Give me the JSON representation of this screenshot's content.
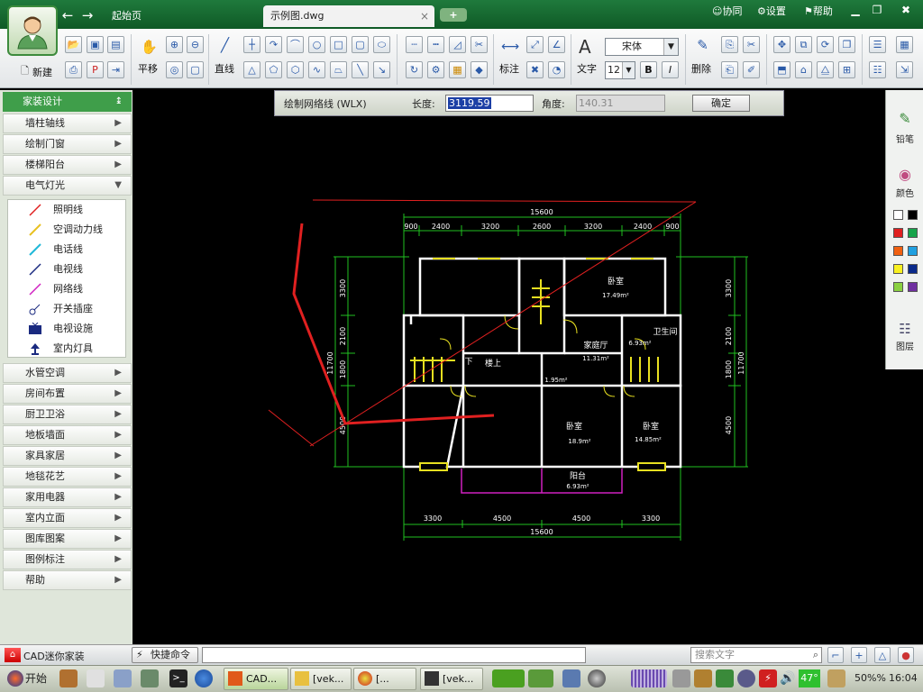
{
  "tabs": {
    "home": "起始页",
    "doc": "示例图.dwg",
    "doc_close": "×",
    "add": "+"
  },
  "header": {
    "collab": "协同",
    "settings": "设置",
    "help": "帮助"
  },
  "toolbar": {
    "new_label": "新建",
    "pan_label": "平移",
    "line_label": "直线",
    "dim_label": "标注",
    "text_label": "文字",
    "font_value": "宋体",
    "size_value": "12",
    "bold": "B",
    "italic": "I",
    "delete_label": "删除"
  },
  "command": {
    "title": "绘制网络线 (WLX)",
    "length_label": "长度:",
    "length_value": "3119.59",
    "angle_label": "角度:",
    "angle_value": "140.31",
    "ok": "确定"
  },
  "sidebar": {
    "title": "家装设计",
    "categories_top": [
      "墙柱轴线",
      "绘制门窗",
      "楼梯阳台",
      "电气灯光"
    ],
    "sub_items": [
      {
        "label": "照明线",
        "icon": "red-line-icon",
        "color": "#e02020"
      },
      {
        "label": "空调动力线",
        "icon": "yellow-line-icon",
        "color": "#e8c020"
      },
      {
        "label": "电话线",
        "icon": "cyan-line-icon",
        "color": "#20b8d8"
      },
      {
        "label": "电视线",
        "icon": "navy-line-icon",
        "color": "#1a2a80"
      },
      {
        "label": "网络线",
        "icon": "magenta-line-icon",
        "color": "#d020c0"
      },
      {
        "label": "开关插座",
        "icon": "switch-icon"
      },
      {
        "label": "电视设施",
        "icon": "tv-icon"
      },
      {
        "label": "室内灯具",
        "icon": "lamp-icon"
      }
    ],
    "categories_bottom": [
      "水管空调",
      "房间布置",
      "厨卫卫浴",
      "地板墙面",
      "家具家居",
      "地毯花艺",
      "家用电器",
      "室内立面",
      "图库图案",
      "图例标注",
      "帮助"
    ]
  },
  "plan": {
    "dims_top": [
      "900",
      "2400",
      "3200",
      "2600",
      "3200",
      "2400",
      "900"
    ],
    "total": "15600",
    "dims_bottom": [
      "3300",
      "4500",
      "4500",
      "3300"
    ],
    "dims_left": [
      "3300",
      "2100",
      "1800",
      "4500"
    ],
    "dims_right": [
      "3300",
      "2100",
      "1800",
      "4500"
    ],
    "height_total": "11700",
    "rooms": [
      {
        "name": "卧室",
        "area": "17.49m²"
      },
      {
        "name": "家庭厅",
        "area": "11.31m²"
      },
      {
        "name": "卫生间",
        "area": "6.93m²"
      },
      {
        "name": "楼上",
        "area": ""
      },
      {
        "name": "下",
        "area": ""
      },
      {
        "name": "卧室",
        "area": "18.9m²"
      },
      {
        "name": "卧室",
        "area": "14.85m²"
      },
      {
        "name": "阳台",
        "area": "6.93m²"
      },
      {
        "name": "",
        "area": "1.95m²"
      }
    ]
  },
  "rightpanel": {
    "pencil": "铅笔",
    "color": "颜色",
    "layer": "图层",
    "swatches": [
      "#ffffff",
      "#000000",
      "#e02020",
      "#16a34a",
      "#f06010",
      "#20a0e0",
      "#f8f020",
      "#0a2a8a",
      "#8ad040",
      "#7030a0"
    ]
  },
  "status": {
    "app_name": "CAD迷你家装",
    "quick_cmd": "快捷命令",
    "search_placeholder": "搜索文字"
  },
  "taskbar": {
    "start": "开始",
    "win1": "CAD...",
    "win2": "[vek...",
    "win3": "[...",
    "win4": "[vek...",
    "temp": "47°",
    "zoom": "50%%",
    "time": "16:04"
  }
}
